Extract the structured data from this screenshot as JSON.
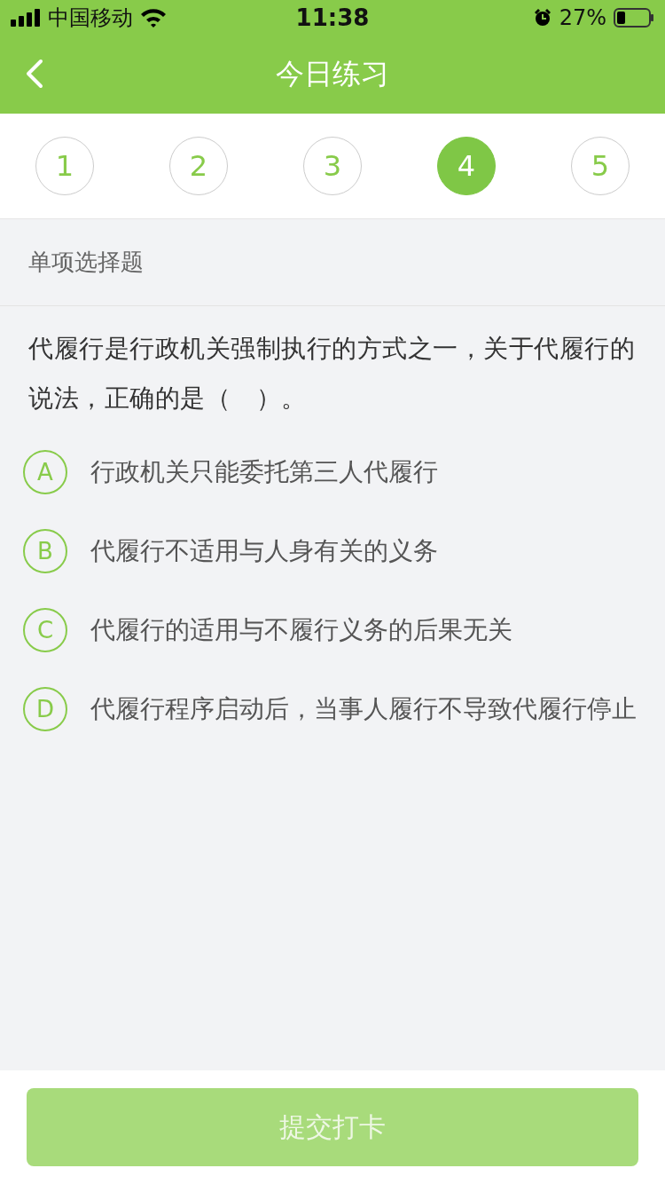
{
  "status_bar": {
    "carrier": "中国移动",
    "time": "11:38",
    "battery": "27%"
  },
  "nav": {
    "title": "今日练习"
  },
  "steps": [
    {
      "label": "1",
      "selected": false
    },
    {
      "label": "2",
      "selected": false
    },
    {
      "label": "3",
      "selected": false
    },
    {
      "label": "4",
      "selected": true
    },
    {
      "label": "5",
      "selected": false
    }
  ],
  "question_type": "单项选择题",
  "question": "代履行是行政机关强制执行的方式之一，关于代履行的说法，正确的是（　）。",
  "options": [
    {
      "letter": "A",
      "text": "行政机关只能委托第三人代履行",
      "selected": false
    },
    {
      "letter": "B",
      "text": "代履行不适用与人身有关的义务",
      "selected": false
    },
    {
      "letter": "C",
      "text": "代履行的适用与不履行义务的后果无关",
      "selected": false
    },
    {
      "letter": "D",
      "text": "代履行程序启动后，当事人履行不导致代履行停止",
      "selected": false
    }
  ],
  "submit": {
    "label": "提交打卡",
    "disabled": true
  }
}
